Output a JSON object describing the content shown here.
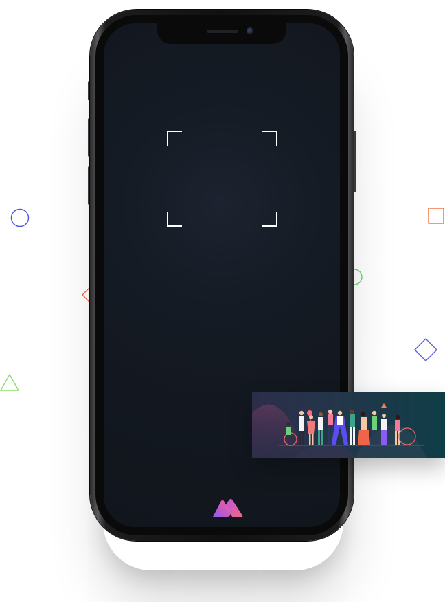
{
  "scene": {
    "kind": "phone-mockup",
    "screen": {
      "view": "camera-scanner",
      "viewfinder": "corner-brackets"
    },
    "logo_icon": "brand-m-logo-icon",
    "card_image": "people-illustration",
    "colors": {
      "background": "#ffffff",
      "screen": "#141a22",
      "viewfinder": "#ffffff",
      "logo_gradient_start": "#8a5cf5",
      "logo_gradient_end": "#ff5c8a",
      "card_start": "#2c2e49",
      "card_end": "#0f3e47"
    },
    "decorations": [
      {
        "shape": "circle",
        "color": "#4c56d8"
      },
      {
        "shape": "square",
        "color": "#f0703c"
      },
      {
        "shape": "circle",
        "color": "#6fd26f"
      },
      {
        "shape": "chevron",
        "color": "#f0644a"
      },
      {
        "shape": "diamond",
        "color": "#5a5ee0"
      },
      {
        "shape": "triangle",
        "color": "#8ddc6a"
      }
    ]
  }
}
